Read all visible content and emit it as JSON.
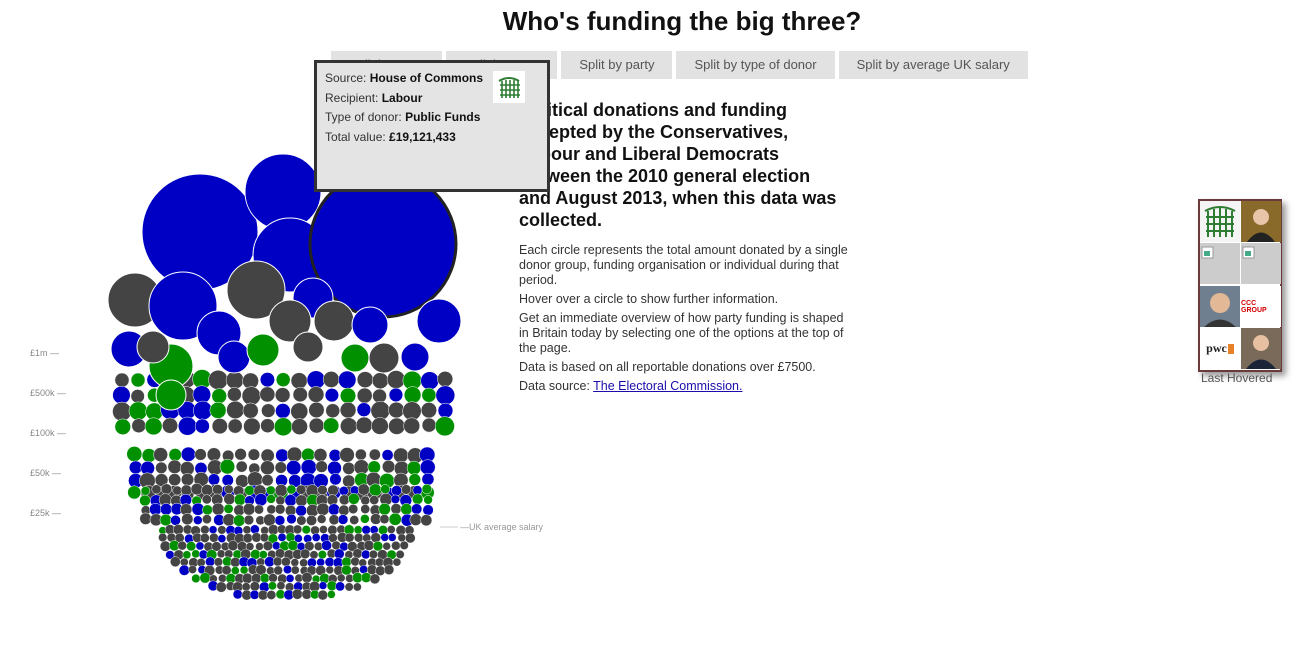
{
  "page": {
    "title": "Who's funding the big three?"
  },
  "buttons": [
    {
      "label": "Split by party"
    },
    {
      "label": "Split by party"
    },
    {
      "label": "Split by party"
    },
    {
      "label": "Split by type of donor"
    },
    {
      "label": "Split by average UK salary"
    }
  ],
  "tooltip": {
    "source_label": "Source:",
    "source": "House of Commons",
    "recipient_label": "Recipient:",
    "recipient": "Labour",
    "donor_type_label": "Type of donor:",
    "donor_type": "Public Funds",
    "value_label": "Total value:",
    "value": "£19,121,433",
    "logo_icon": "portcullis-icon"
  },
  "intro": {
    "headline": "Political donations and funding accepted by the Conservatives, Labour and Liberal Democrats between the 2010 general election and August 2013, when this data was collected.",
    "paragraphs": [
      "Each circle represents the total amount donated by a single donor group, funding organisation or individual during that period.",
      "Hover over a circle to show further information.",
      "Get an immediate overview of how party funding is shaped in Britain today by selecting one of the options at the top of the page.",
      "Data is based on all reportable donations over £7500."
    ],
    "source_prefix": "Data source:",
    "source_link": "The Electoral Commission."
  },
  "last_hovered": {
    "label": "Last Hovered",
    "thumbs": [
      "portcullis-icon",
      "portrait-photo",
      "broken-image-icon",
      "broken-image-icon",
      "portrait-photo",
      "ccc-group-logo",
      "pwc-logo",
      "portrait-photo"
    ],
    "ccc_text": "CCC GROUP",
    "pwc_text": "pwc"
  },
  "colors": {
    "Labour": "#d00000",
    "Conservative": "#0000c4",
    "Liberal Democrats": "#009000",
    "other": "#444444",
    "Unknown": "#444444"
  },
  "chart_data": {
    "type": "bubble",
    "title": "Who's funding the big three?",
    "y_scale_labels": [
      "£1m —",
      "£500k —",
      "£100k —",
      "£50k —",
      "£25k —"
    ],
    "reference_line_label": "—UK average salary",
    "highlighted": {
      "source": "House of Commons",
      "recipient": "Labour",
      "donor_type": "Public Funds",
      "value": 19121433
    },
    "bubbles": [
      {
        "r": 58,
        "party": "Conservative"
      },
      {
        "r": 38,
        "party": "Conservative"
      },
      {
        "r": 37,
        "party": "Conservative"
      },
      {
        "r": 73,
        "party": "Conservative",
        "highlight": true
      },
      {
        "r": 27,
        "party": "other"
      },
      {
        "r": 34,
        "party": "Conservative"
      },
      {
        "r": 29,
        "party": "other"
      },
      {
        "r": 20,
        "party": "Conservative"
      },
      {
        "r": 22,
        "party": "Conservative"
      },
      {
        "r": 21,
        "party": "other"
      },
      {
        "r": 20,
        "party": "other"
      },
      {
        "r": 18,
        "party": "Conservative"
      },
      {
        "r": 22,
        "party": "Liberal Democrats"
      },
      {
        "r": 22,
        "party": "Conservative"
      },
      {
        "r": 18,
        "party": "Conservative"
      },
      {
        "r": 16,
        "party": "other"
      },
      {
        "r": 15,
        "party": "Liberal Democrats"
      },
      {
        "r": 16,
        "party": "Conservative"
      },
      {
        "r": 16,
        "party": "Liberal Democrats"
      },
      {
        "r": 15,
        "party": "other"
      },
      {
        "r": 15,
        "party": "other"
      },
      {
        "r": 14,
        "party": "Conservative"
      },
      {
        "r": 14,
        "party": "Liberal Democrats"
      }
    ],
    "small_bubble_counts": {
      "tier1": 120,
      "tier2": 120,
      "tier3": 180,
      "tier4": 300
    }
  }
}
